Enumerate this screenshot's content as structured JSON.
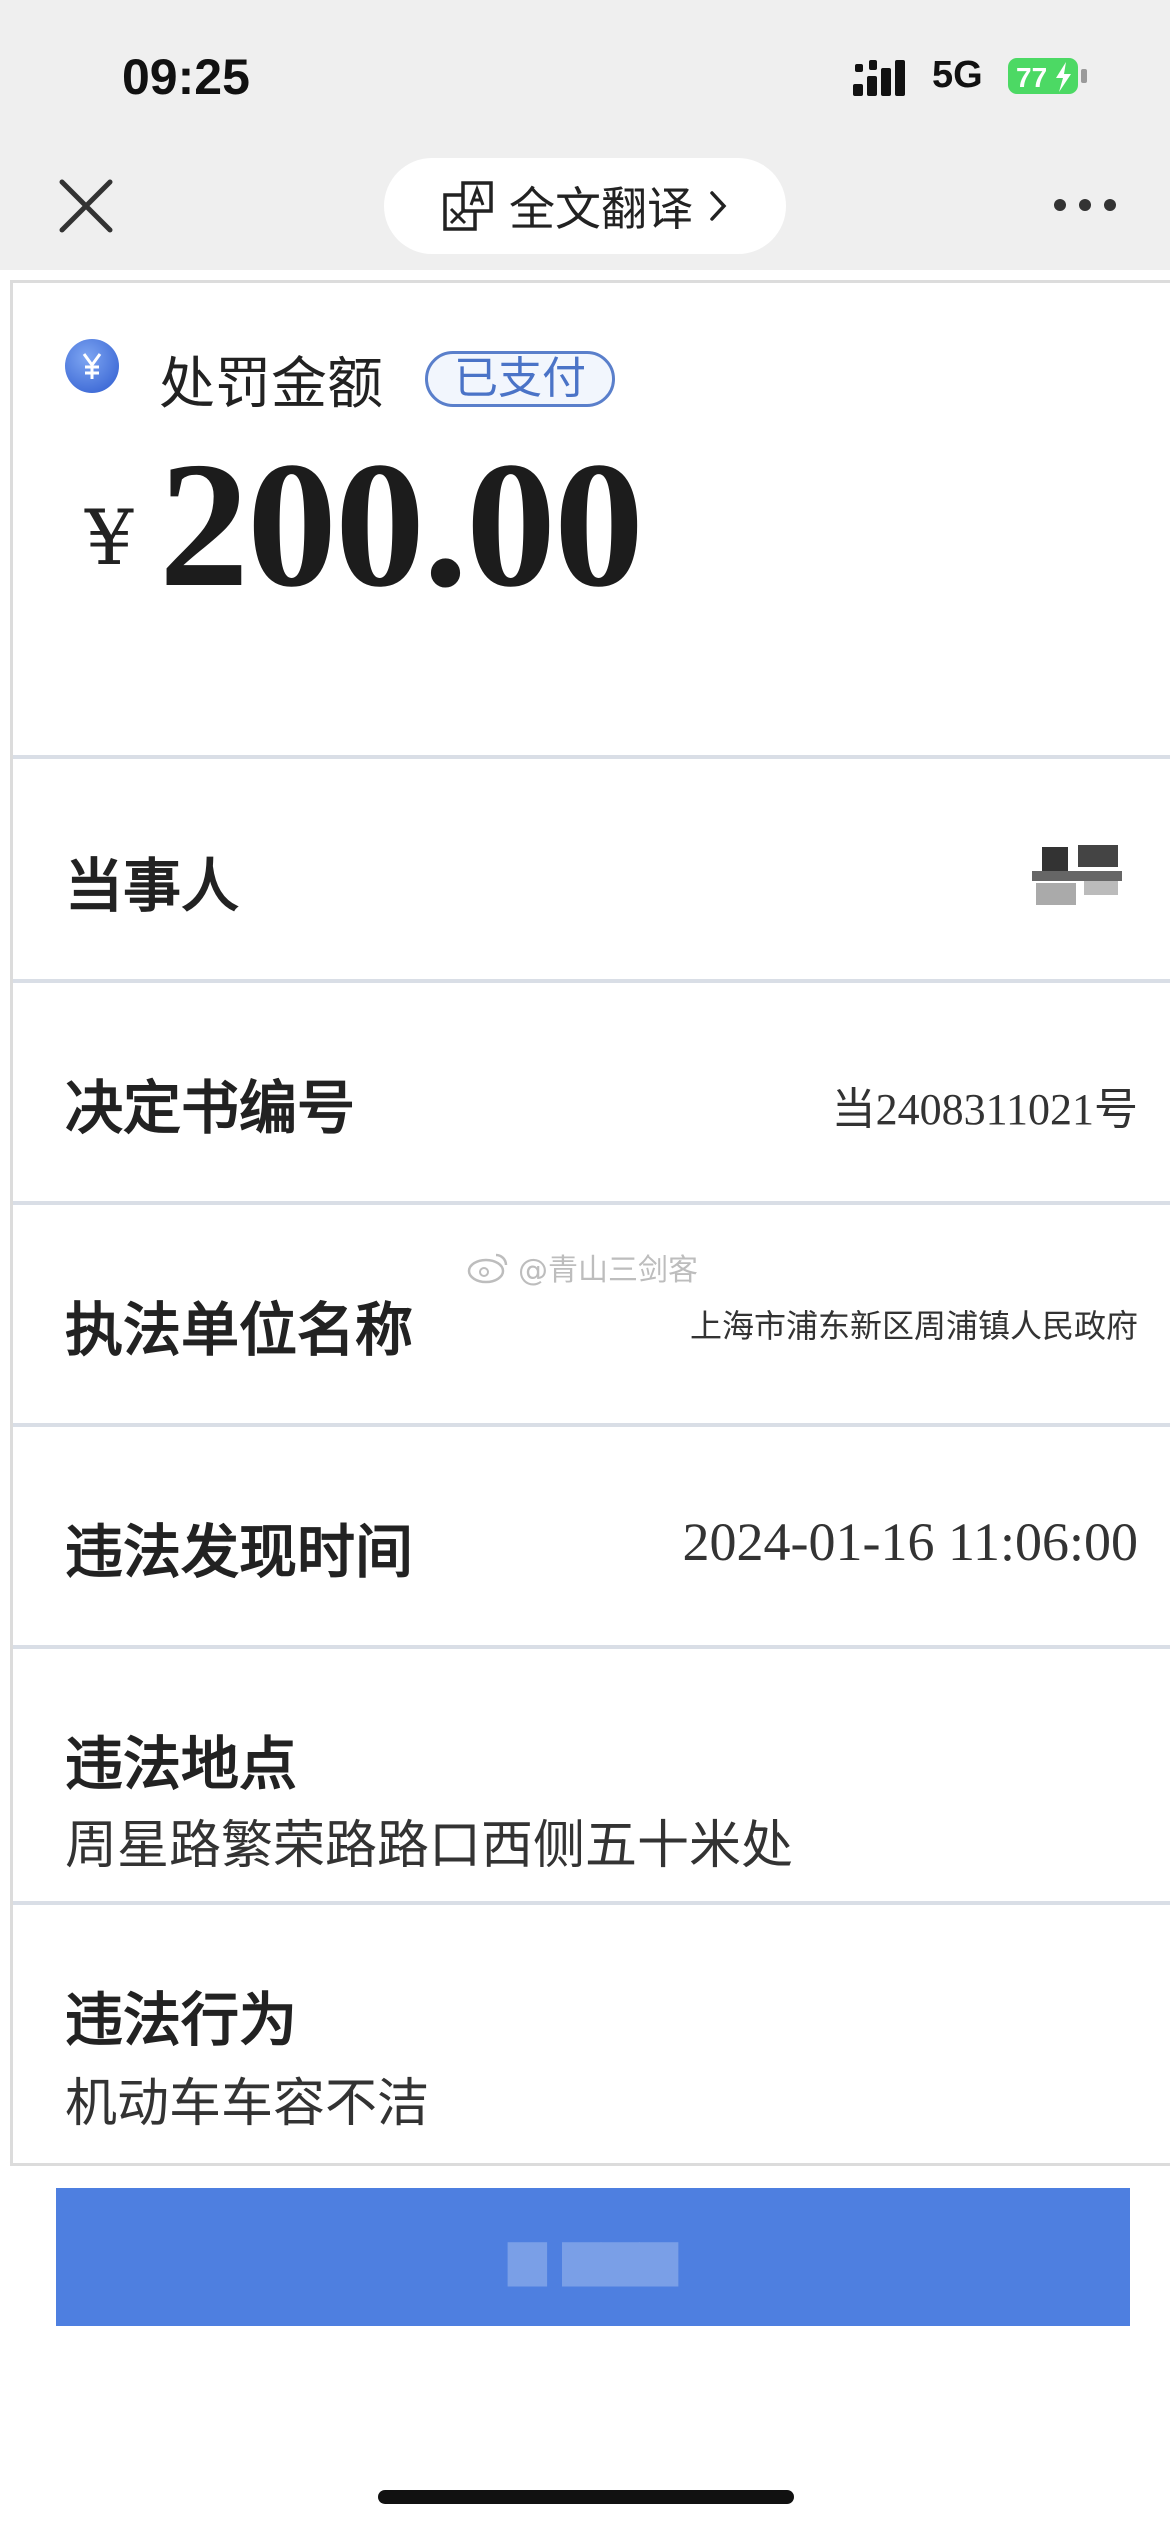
{
  "status_bar": {
    "time": "09:25",
    "network": "5G",
    "battery": "77"
  },
  "header": {
    "translate_label": "全文翻译",
    "icons": [
      "close-icon",
      "translate-icon",
      "chevron-right-icon",
      "more-icon"
    ]
  },
  "penalty": {
    "amount_label": "处罚金额",
    "status_badge": "已支付",
    "currency": "¥",
    "amount": "200.00"
  },
  "details": {
    "party_label": "当事人",
    "decision_label": "决定书编号",
    "decision_value": "当2408311021号",
    "unit_label": "执法单位名称",
    "unit_value": "上海市浦东新区周浦镇人民政府",
    "time_label": "违法发现时间",
    "time_value": "2024-01-16 11:06:00",
    "location_label": "违法地点",
    "location_value": "周星路繁荣路路口西侧五十米处",
    "behavior_label": "违法行为",
    "behavior_value": "机动车车容不洁"
  },
  "watermark": "@青山三剑客",
  "colors": {
    "accent": "#4e7fe0",
    "badge": "#4a73c7",
    "battery": "#4cd964"
  }
}
